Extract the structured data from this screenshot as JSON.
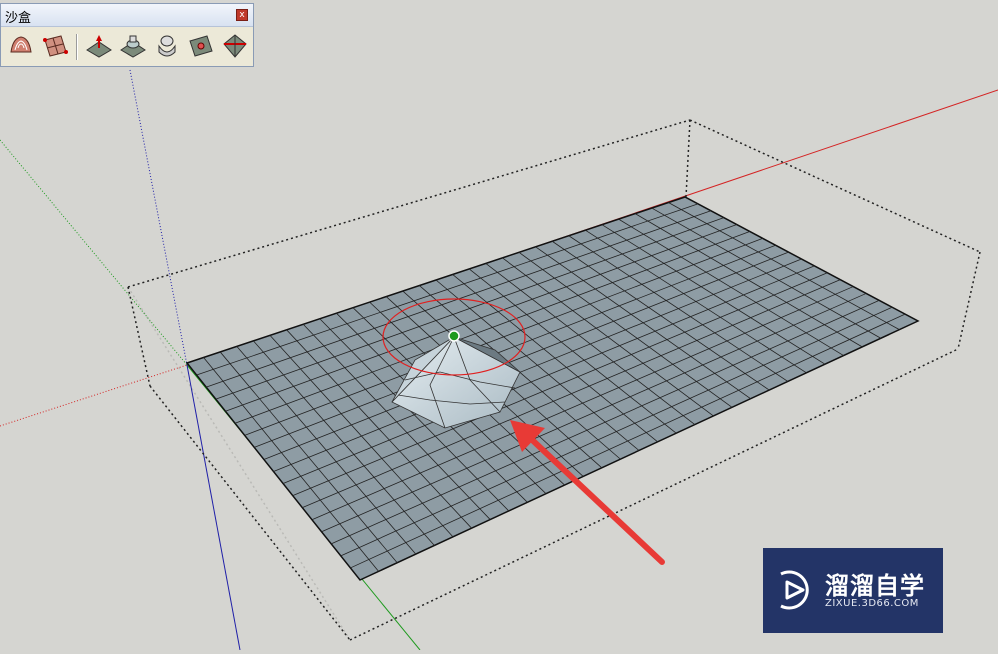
{
  "sandbox_toolbar": {
    "title": "沙盒",
    "close_label": "x",
    "tools": [
      {
        "name": "from-contours-tool",
        "icon": "contour-icon"
      },
      {
        "name": "from-scratch-tool",
        "icon": "grid-icon"
      },
      {
        "name": "smoove-tool",
        "icon": "smoove-icon"
      },
      {
        "name": "stamp-tool",
        "icon": "stamp-icon"
      },
      {
        "name": "drape-tool",
        "icon": "drape-icon"
      },
      {
        "name": "add-detail-tool",
        "icon": "add-detail-icon"
      },
      {
        "name": "flip-edge-tool",
        "icon": "flip-edge-icon"
      }
    ]
  },
  "scene": {
    "axis_colors": {
      "red": "#d42424",
      "green": "#1e9a1e",
      "blue": "#1f1fa8"
    },
    "surface_color": "#8e9ca4",
    "selection_circle_color": "#e02020",
    "arrow_color": "#e83a36"
  },
  "watermark": {
    "chinese": "溜溜自学",
    "english": "ZIXUE.3D66.COM"
  }
}
